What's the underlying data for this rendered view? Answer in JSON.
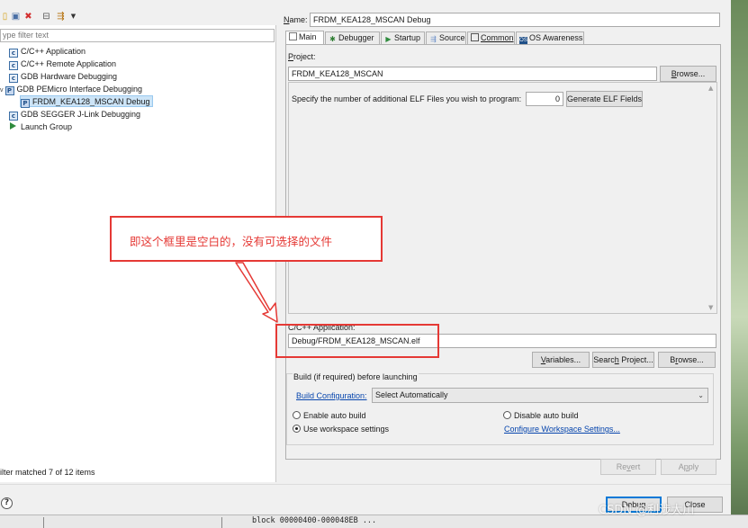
{
  "left": {
    "filter_placeholder": "ype filter text",
    "items": [
      {
        "label": "C/C++ Application",
        "icon": "c-config-icon"
      },
      {
        "label": "C/C++ Remote Application",
        "icon": "c-config-icon"
      },
      {
        "label": "GDB Hardware Debugging",
        "icon": "c-config-icon"
      },
      {
        "label": "GDB PEMicro Interface Debugging",
        "icon": "pemicro-icon"
      },
      {
        "label": "FRDM_KEA128_MSCAN Debug",
        "icon": "pemicro-icon"
      },
      {
        "label": "GDB SEGGER J-Link Debugging",
        "icon": "c-config-icon"
      },
      {
        "label": "Launch Group",
        "icon": "launch-group-icon"
      }
    ],
    "status": "ilter matched 7 of 12 items"
  },
  "right": {
    "name_label": "Name:",
    "name_value": "FRDM_KEA128_MSCAN Debug",
    "tabs": [
      {
        "label": "Main"
      },
      {
        "label": "Debugger"
      },
      {
        "label": "Startup"
      },
      {
        "label": "Source"
      },
      {
        "label": "Common"
      },
      {
        "label": "OS Awareness"
      }
    ],
    "project_label": "Project:",
    "project_value": "FRDM_KEA128_MSCAN",
    "browse_label": "Browse...",
    "elf_prompt": "Specify the number of additional ELF Files you wish to program:",
    "elf_count": "0",
    "generate_elf_label": "Generate ELF Fields",
    "app_label": "C/C++ Application:",
    "app_value": "Debug/FRDM_KEA128_MSCAN.elf",
    "variables_label": "Variables...",
    "search_project_label": "Search Project...",
    "browse2_label": "Browse...",
    "build_group_label": "Build (if required) before launching",
    "build_config_label": "Build Configuration:",
    "build_config_value": "Select Automatically",
    "enable_auto_build": "Enable auto build",
    "disable_auto_build": "Disable auto build",
    "use_workspace": "Use workspace settings",
    "configure_workspace": "Configure Workspace Settings...",
    "revert_label": "Revert",
    "apply_label": "Apply"
  },
  "bottom": {
    "debug_label": "Debug",
    "close_label": "Close"
  },
  "background": {
    "console_text": "block 00000400-000048EB ..."
  },
  "annotation": {
    "text": "即这个框里是空白的，没有可选择的文件",
    "color": "#e53935"
  },
  "watermark": "CSDN @利涉大川"
}
